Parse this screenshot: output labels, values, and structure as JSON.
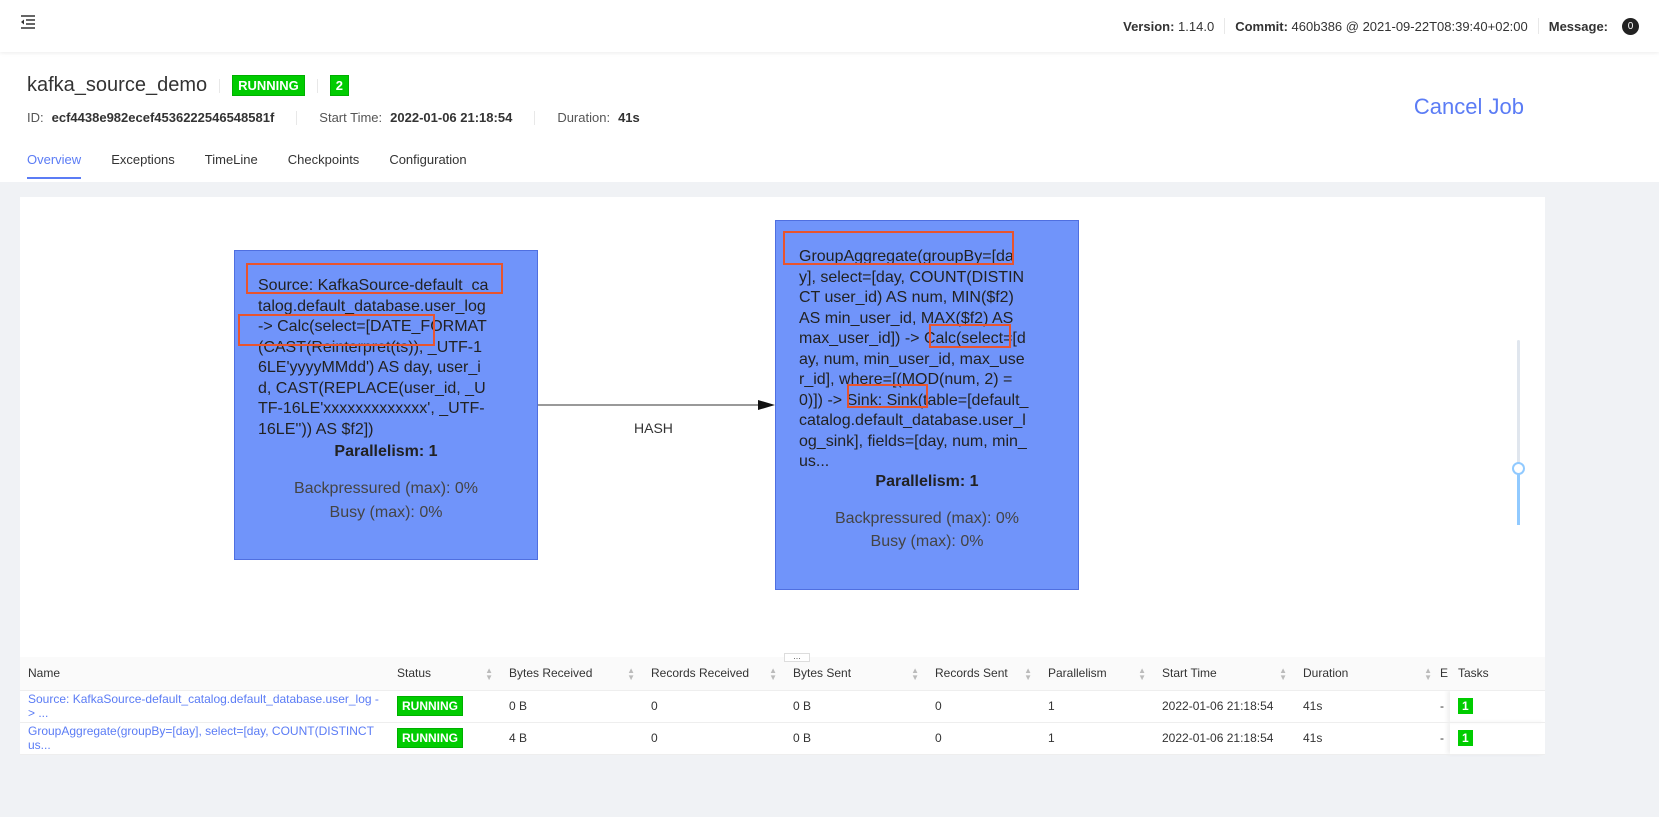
{
  "topbar": {
    "menu_icon": "menu-fold-icon",
    "version_label": "Version:",
    "version": "1.14.0",
    "commit_label": "Commit:",
    "commit": "460b386 @ 2021-09-22T08:39:40+02:00",
    "message_label": "Message:",
    "message_count": "0"
  },
  "job": {
    "name": "kafka_source_demo",
    "status": "RUNNING",
    "running_tasks": "2",
    "id_label": "ID:",
    "id": "ecf4438e982ecef4536222546548581f",
    "start_label": "Start Time:",
    "start_time": "2022-01-06 21:18:54",
    "duration_label": "Duration:",
    "duration": "41s",
    "cancel_label": "Cancel Job"
  },
  "tabs": [
    "Overview",
    "Exceptions",
    "TimeLine",
    "Checkpoints",
    "Configuration"
  ],
  "graph": {
    "edge_label": "HASH",
    "nodes": [
      {
        "lines": "Source: KafkaSource-default_ca\ntalog.default_database.user_log\n-> Calc(select=[DATE_FORMAT\n(CAST(Reinterpret(ts)), _UTF-1\n6LE'yyyyMMdd') AS day, user_i\nd, CAST(REPLACE(user_id, _U\nTF-16LE'xxxxxxxxxxxxx', _UTF-\n16LE'')) AS $f2])",
        "parallelism": "Parallelism: 1",
        "backpressured": "Backpressured (max): 0%",
        "busy": "Busy (max): 0%"
      },
      {
        "lines": "GroupAggregate(groupBy=[da\ny], select=[day, COUNT(DISTIN\nCT user_id) AS num, MIN($f2)\nAS min_user_id, MAX($f2) AS\nmax_user_id]) -> Calc(select=[d\nay, num, min_user_id, max_use\nr_id], where=[(MOD(num, 2) =\n0)]) -> Sink: Sink(table=[default_\ncatalog.default_database.user_l\nog_sink], fields=[day, num, min_\nus...",
        "parallelism": "Parallelism: 1",
        "backpressured": "Backpressured (max): 0%",
        "busy": "Busy (max): 0%"
      }
    ]
  },
  "table": {
    "columns": [
      "Name",
      "Status",
      "Bytes Received",
      "Records Received",
      "Bytes Sent",
      "Records Sent",
      "Parallelism",
      "Start Time",
      "Duration",
      "E",
      "Tasks"
    ],
    "rows": [
      {
        "name": "Source: KafkaSource-default_catalog.default_database.user_log -> ...",
        "status": "RUNNING",
        "bytes_received": "0 B",
        "records_received": "0",
        "bytes_sent": "0 B",
        "records_sent": "0",
        "parallelism": "1",
        "start_time": "2022-01-06 21:18:54",
        "duration": "41s",
        "end": "-",
        "tasks": "1"
      },
      {
        "name": "GroupAggregate(groupBy=[day], select=[day, COUNT(DISTINCT us...",
        "status": "RUNNING",
        "bytes_received": "4 B",
        "records_received": "0",
        "bytes_sent": "0 B",
        "records_sent": "0",
        "parallelism": "1",
        "start_time": "2022-01-06 21:18:54",
        "duration": "41s",
        "end": "-",
        "tasks": "1"
      }
    ]
  },
  "colors": {
    "accent": "#5b7cf5",
    "running": "#00cc00",
    "node_fill": "#7094fa",
    "highlight_box": "#e8542e"
  }
}
